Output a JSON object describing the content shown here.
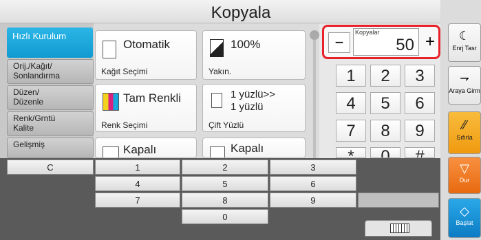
{
  "title": "Kopyala",
  "left_tabs": {
    "active": "Hızlı Kurulum",
    "items": [
      "Orij./Kağıt/\nSonlandırma",
      "Düzen/\nDüzenle",
      "Renk/Grntü\nKalite",
      "Gelişmiş"
    ]
  },
  "cards": {
    "paper": {
      "title": "Otomatik",
      "sub": "Kağıt Seçimi"
    },
    "zoom": {
      "title": "100%",
      "sub": "Yakın."
    },
    "color": {
      "title": "Tam Renkli",
      "sub": "Renk Seçimi"
    },
    "duplex": {
      "title": "1 yüzlü>>\n1 yüzlü",
      "sub": "Çift Yüzlü"
    },
    "combine": {
      "title": "Kapalı"
    },
    "margin": {
      "title": "Kapalı"
    }
  },
  "copies": {
    "label": "Kopyalar",
    "value": "50",
    "minus": "−",
    "plus": "+"
  },
  "numpad": [
    "1",
    "2",
    "3",
    "4",
    "5",
    "6",
    "7",
    "8",
    "9",
    "*",
    "0",
    "#"
  ],
  "right_buttons": {
    "energy": "Enrj Tasr",
    "interrupt": "Araya Girm",
    "reset": "Sıfırla",
    "stop": "Dur",
    "start": "Başlat"
  },
  "keyboard": {
    "clear": "C",
    "rows": [
      [
        "1",
        "2",
        "3"
      ],
      [
        "4",
        "5",
        "6"
      ],
      [
        "7",
        "8",
        "9"
      ]
    ],
    "zero": "0"
  },
  "colors": {
    "accent_blue": "#17a7dc",
    "highlight_red": "#e8222a",
    "reset_orange": "#f4a21c",
    "stop_orange": "#f07a1e",
    "start_blue": "#1a8fd0"
  }
}
